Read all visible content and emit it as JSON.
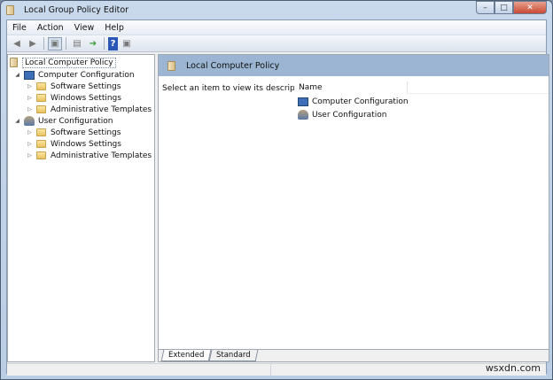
{
  "window": {
    "title": "Local Group Policy Editor",
    "minimize": "–",
    "maximize": "□",
    "close": "✕"
  },
  "menu": [
    "File",
    "Action",
    "View",
    "Help"
  ],
  "toolbar": [
    "back-icon",
    "forward-icon",
    "show-hide-tree-icon",
    "properties-icon",
    "export-list-icon",
    "help-icon",
    "show-hide-action-pane-icon"
  ],
  "tree": {
    "root": "Local Computer Policy",
    "computer": {
      "label": "Computer Configuration",
      "children": [
        "Software Settings",
        "Windows Settings",
        "Administrative Templates"
      ]
    },
    "user": {
      "label": "User Configuration",
      "children": [
        "Software Settings",
        "Windows Settings",
        "Administrative Templates"
      ]
    }
  },
  "right": {
    "header": "Local Computer Policy",
    "description": "Select an item to view its description.",
    "column_name": "Name",
    "items": [
      "Computer Configuration",
      "User Configuration"
    ],
    "tabs": [
      "Extended",
      "Standard"
    ]
  },
  "watermark": "wsxdn.com"
}
